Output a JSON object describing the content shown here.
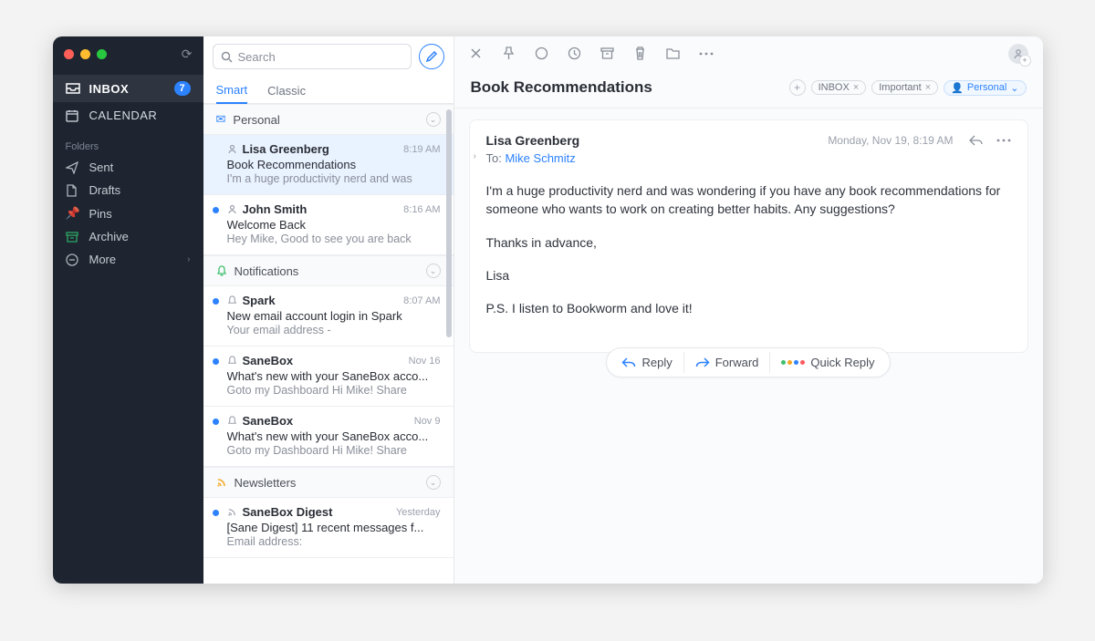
{
  "search": {
    "placeholder": "Search"
  },
  "sidebar": {
    "inbox": {
      "label": "INBOX",
      "count": "7"
    },
    "calendar": {
      "label": "CALENDAR"
    },
    "folders_label": "Folders",
    "folders": [
      {
        "label": "Sent"
      },
      {
        "label": "Drafts"
      },
      {
        "label": "Pins"
      },
      {
        "label": "Archive"
      },
      {
        "label": "More"
      }
    ]
  },
  "tabs": {
    "smart": "Smart",
    "classic": "Classic"
  },
  "groups": [
    {
      "id": "personal",
      "label": "Personal",
      "messages": [
        {
          "sender": "Lisa Greenberg",
          "time": "8:19 AM",
          "subject": "Book Recommendations",
          "preview": "I'm a huge productivity nerd and was",
          "selected": true,
          "unread": false,
          "icon": "person"
        },
        {
          "sender": "John Smith",
          "time": "8:16 AM",
          "subject": "Welcome Back",
          "preview": "Hey Mike, Good to see you are back",
          "selected": false,
          "unread": true,
          "icon": "person"
        }
      ]
    },
    {
      "id": "notifications",
      "label": "Notifications",
      "messages": [
        {
          "sender": "Spark",
          "time": "8:07 AM",
          "subject": "New email account login in Spark",
          "preview": "Your email address -",
          "unread": true,
          "icon": "bell"
        },
        {
          "sender": "SaneBox",
          "time": "Nov 16",
          "subject": "What's new with your SaneBox acco...",
          "preview": "Goto my Dashboard Hi Mike! Share",
          "unread": true,
          "icon": "bell"
        },
        {
          "sender": "SaneBox",
          "time": "Nov 9",
          "subject": "What's new with your SaneBox acco...",
          "preview": "Goto my Dashboard Hi Mike! Share",
          "unread": true,
          "icon": "bell"
        }
      ]
    },
    {
      "id": "newsletters",
      "label": "Newsletters",
      "messages": [
        {
          "sender": "SaneBox Digest",
          "time": "Yesterday",
          "subject": "[Sane Digest] 11 recent messages f...",
          "preview": "Email address:",
          "unread": true,
          "icon": "rss"
        }
      ]
    }
  ],
  "reader": {
    "title": "Book Recommendations",
    "chips": {
      "inbox": "INBOX",
      "important": "Important",
      "personal": "Personal"
    },
    "sender": "Lisa Greenberg",
    "date": "Monday, Nov 19, 8:19 AM",
    "to_label": "To:",
    "to_name": "Mike Schmitz",
    "body": {
      "p1": "I'm a huge productivity nerd and was wondering if you have any book recommendations for someone who wants to work on creating better habits. Any suggestions?",
      "p2": "Thanks in advance,",
      "p3": "Lisa",
      "p4": "P.S. I listen to Bookworm and love it!"
    },
    "actions": {
      "reply": "Reply",
      "forward": "Forward",
      "quick": "Quick Reply"
    }
  }
}
